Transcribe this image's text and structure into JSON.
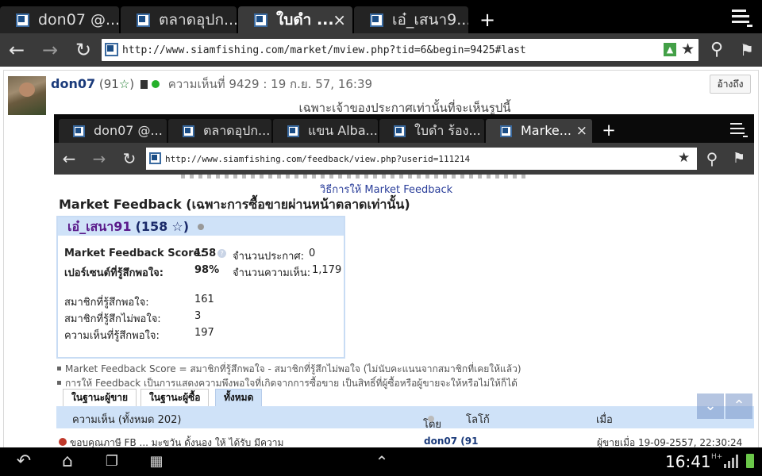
{
  "browser": {
    "tabs": [
      {
        "title": "don07 @..."
      },
      {
        "title": "ตลาดอุปก..."
      },
      {
        "title": "ใบดำ ..."
      },
      {
        "title": "เอ๋_เสนา9..."
      }
    ],
    "close_glyph": "×",
    "new_tab_glyph": "+",
    "url": "http://www.siamfishing.com/market/mview.php?tid=6&begin=9425#last",
    "icons": [
      "back-icon",
      "forward-icon",
      "reload-icon",
      "extension-icon",
      "star-icon",
      "search-icon",
      "bookmarks-icon",
      "menu-icon"
    ]
  },
  "post": {
    "username": "don07",
    "count": "(91",
    "count_close": ")",
    "meta": "ความเห็นที่ 9429 : 19 ก.ย. 57, 16:39",
    "quote_button": "อ้างถึง",
    "owner_only": "เฉพาะเจ้าของประกาศเท่านั้นที่จะเห็นรูปนี้"
  },
  "inner": {
    "tabs": [
      {
        "title": "don07 @..."
      },
      {
        "title": "ตลาดอุปก..."
      },
      {
        "title": "แขน Alba..."
      },
      {
        "title": "ใบดำ ร้อง..."
      },
      {
        "title": "Marke..."
      }
    ],
    "url": "http://www.siamfishing.com/feedback/view.php?userid=111214",
    "howto_link": "วิธีการให้ Market Feedback",
    "title": "Market Feedback (เฉพาะการซื้อขายผ่านหน้าตลาดเท่านั้น)",
    "feedback": {
      "name": "เอ๋_เสนา91",
      "score_open": "(158",
      "score_close": ")",
      "score_label": "Market Feedback Score:",
      "score_value": "158",
      "percent_label": "เปอร์เซนต์ที่รู้สึกพอใจ:",
      "percent_value": "98%",
      "ads_label": "จำนวนประกาศ:",
      "ads_value": "0",
      "comments_label": "จำนวนความเห็น:",
      "comments_value": "1,179",
      "satisfied_label": "สมาชิกที่รู้สึกพอใจ:",
      "satisfied_value": "161",
      "unsatisfied_label": "สมาชิกที่รู้สึกไม่พอใจ:",
      "unsatisfied_value": "3",
      "sat_comments_label": "ความเห็นที่รู้สึกพอใจ:",
      "sat_comments_value": "197"
    },
    "notes": [
      "Market Feedback Score = สมาชิกที่รู้สึกพอใจ - สมาชิกที่รู้สึกไม่พอใจ (ไม่นับคะแนนจากสมาชิกที่เคยให้แล้ว)",
      "การให้ Feedback เป็นการแสดงความพึงพอใจที่เกิดจากการซื้อขาย เป็นสิทธิ์ที่ผู้ซื้อหรือผู้ขายจะให้หรือไม่ให้ก็ได้"
    ],
    "view_tabs": [
      {
        "label": "ในฐานะผู้ขาย"
      },
      {
        "label": "ในฐานะผู้ซื้อ"
      },
      {
        "label": "ทั้งหมด"
      }
    ],
    "list_header": {
      "comments": "ความเห็น (ทั้งหมด 202)",
      "by": "โดย",
      "logo": "โลโก้",
      "when": "เมื่อ"
    },
    "cut_row": {
      "text": "ขอบคุณภาษี FB ... มะขวัน ดั้งนอง ให้ ได้รับ มีความ",
      "by": "don07 (91",
      "when": "ผู้ขายเมื่อ 19-09-2557, 22:30:24"
    }
  },
  "statusbar": {
    "time": "16:41",
    "net": "H+"
  }
}
